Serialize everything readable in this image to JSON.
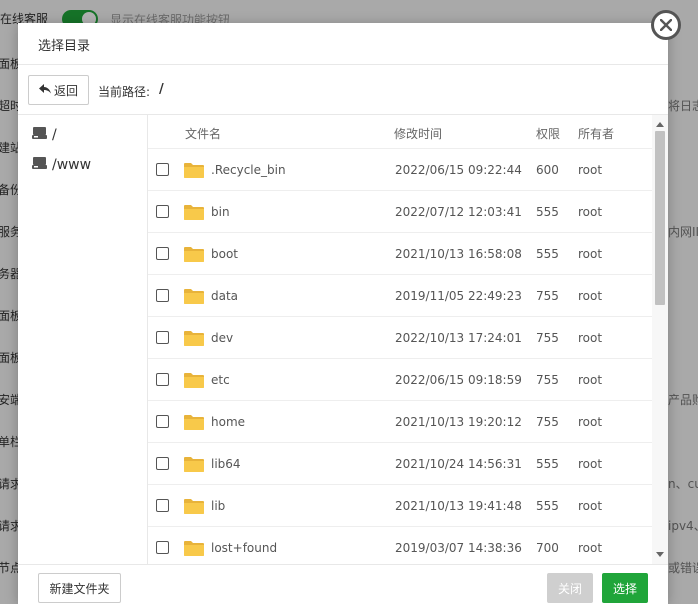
{
  "background": {
    "top_label": "在线客服",
    "top_desc": "显示在线客服功能按钮",
    "left_labels": [
      "面板",
      "超时",
      "建站",
      "备份",
      "服务",
      "务器",
      "面板",
      "面板",
      "安端",
      "单栏",
      "请求",
      "请求",
      "节点"
    ],
    "right_labels": [
      "将日志",
      "内网II",
      "产品购",
      "n、cu",
      "ipv4、",
      "或错误"
    ]
  },
  "dialog": {
    "title": "选择目录",
    "back_label": "返回",
    "path_label": "当前路径:",
    "path_value": "/",
    "sidebar": [
      {
        "label": "/"
      },
      {
        "label": "/www"
      }
    ],
    "columns": {
      "name": "文件名",
      "mtime": "修改时间",
      "perm": "权限",
      "owner": "所有者"
    },
    "files": [
      {
        "name": ".Recycle_bin",
        "mtime": "2022/06/15 09:22:44",
        "perm": "600",
        "owner": "root"
      },
      {
        "name": "bin",
        "mtime": "2022/07/12 12:03:41",
        "perm": "555",
        "owner": "root"
      },
      {
        "name": "boot",
        "mtime": "2021/10/13 16:58:08",
        "perm": "555",
        "owner": "root"
      },
      {
        "name": "data",
        "mtime": "2019/11/05 22:49:23",
        "perm": "755",
        "owner": "root"
      },
      {
        "name": "dev",
        "mtime": "2022/10/13 17:24:01",
        "perm": "755",
        "owner": "root"
      },
      {
        "name": "etc",
        "mtime": "2022/06/15 09:18:59",
        "perm": "755",
        "owner": "root"
      },
      {
        "name": "home",
        "mtime": "2021/10/13 19:20:12",
        "perm": "755",
        "owner": "root"
      },
      {
        "name": "lib64",
        "mtime": "2021/10/24 14:56:31",
        "perm": "555",
        "owner": "root"
      },
      {
        "name": "lib",
        "mtime": "2021/10/13 19:41:48",
        "perm": "555",
        "owner": "root"
      },
      {
        "name": "lost+found",
        "mtime": "2019/03/07 14:38:36",
        "perm": "700",
        "owner": "root"
      }
    ],
    "new_folder_label": "新建文件夹",
    "close_label": "关闭",
    "select_label": "选择"
  },
  "colors": {
    "accent": "#20a53a",
    "folder": "#f8c94a",
    "disabled": "#cfcfcf"
  },
  "icons": {
    "back": "arrow-back-icon",
    "drive": "hard-drive-icon",
    "folder": "folder-icon",
    "close": "close-icon"
  }
}
